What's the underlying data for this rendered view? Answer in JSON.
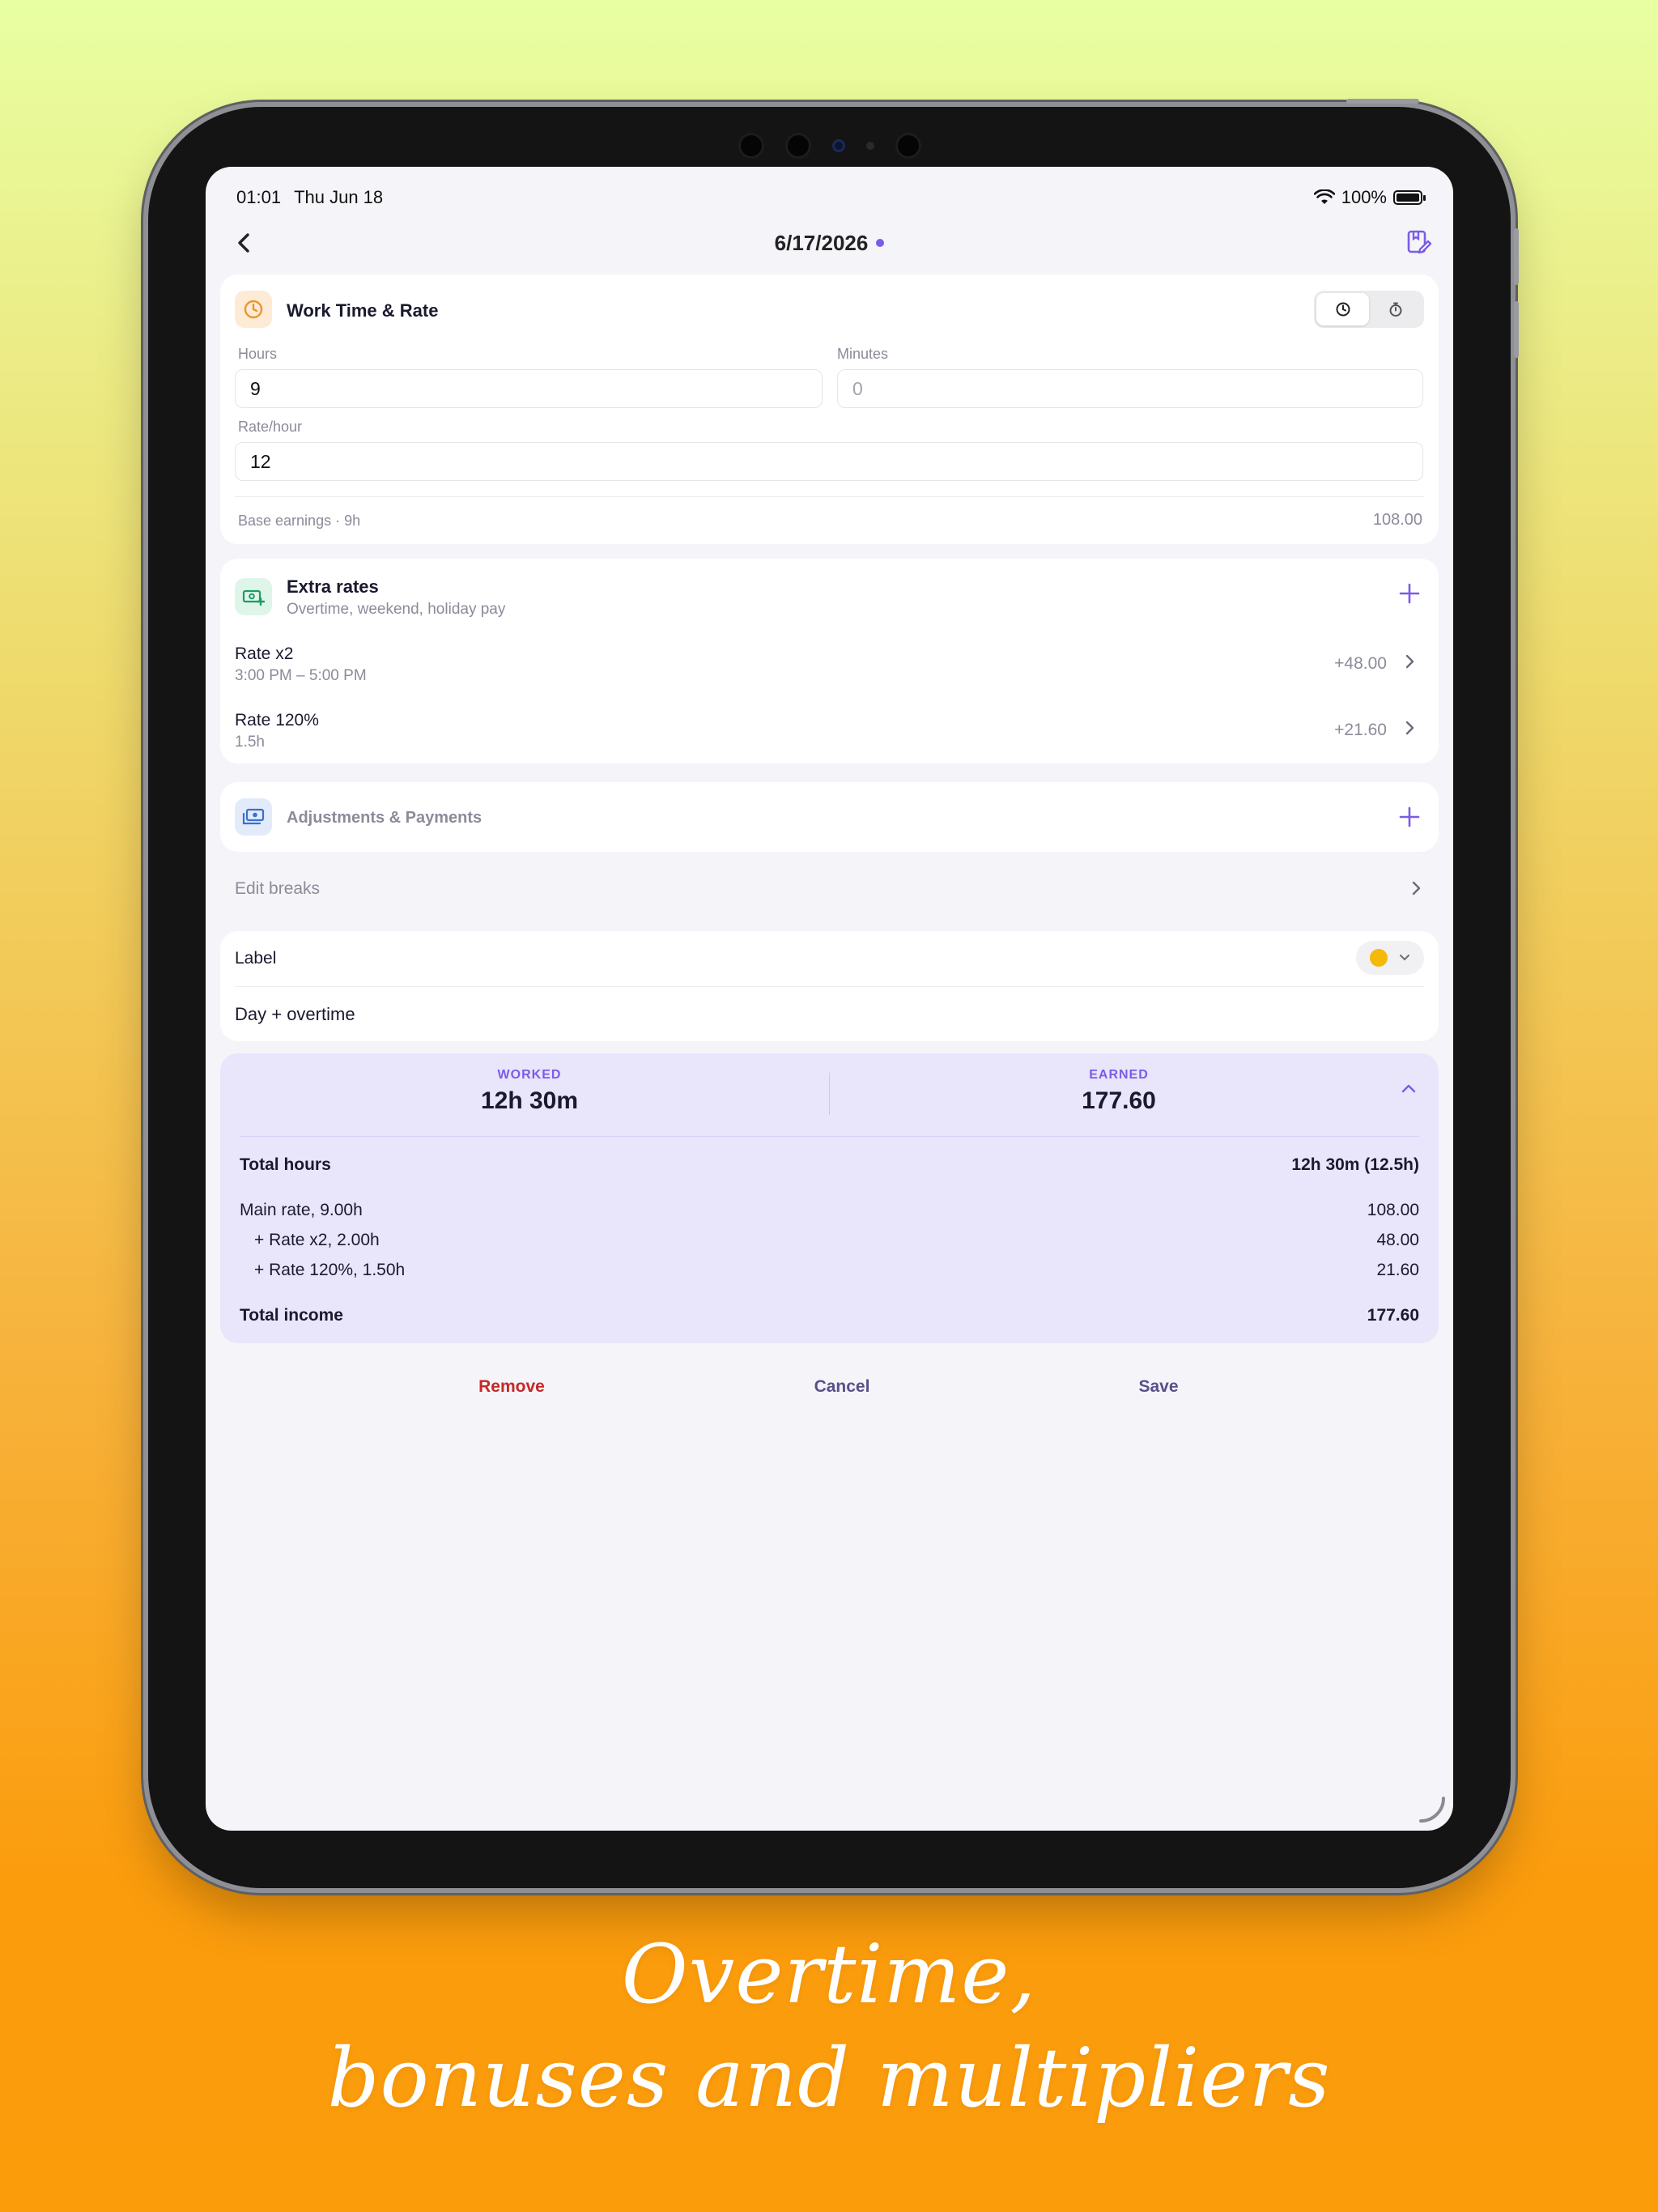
{
  "status": {
    "time": "01:01",
    "date": "Thu Jun 18",
    "battery": "100%"
  },
  "nav": {
    "title": "6/17/2026"
  },
  "work": {
    "title": "Work Time & Rate",
    "hours_label": "Hours",
    "hours_value": "9",
    "minutes_label": "Minutes",
    "minutes_placeholder": "0",
    "rate_label": "Rate/hour",
    "rate_value": "12",
    "base_label": "Base earnings · 9h",
    "base_value": "108.00"
  },
  "extra": {
    "title": "Extra rates",
    "subtitle": "Overtime, weekend, holiday pay",
    "items": [
      {
        "name": "Rate x2",
        "detail": "3:00 PM – 5:00 PM",
        "amount": "+48.00"
      },
      {
        "name": "Rate 120%",
        "detail": "1.5h",
        "amount": "+21.60"
      }
    ]
  },
  "adjustments": {
    "title": "Adjustments & Payments"
  },
  "breaks": {
    "label": "Edit breaks"
  },
  "label_section": {
    "title": "Label",
    "value": "Day + overtime",
    "color": "#f5b90a"
  },
  "summary": {
    "worked_label": "WORKED",
    "worked_value": "12h 30m",
    "earned_label": "EARNED",
    "earned_value": "177.60",
    "total_hours_label": "Total hours",
    "total_hours_value": "12h 30m (12.5h)",
    "lines": [
      {
        "label": "Main rate, 9.00h",
        "value": "108.00"
      },
      {
        "label": "+ Rate x2, 2.00h",
        "value": "48.00"
      },
      {
        "label": "+ Rate 120%, 1.50h",
        "value": "21.60"
      }
    ],
    "total_income_label": "Total income",
    "total_income_value": "177.60"
  },
  "actions": {
    "remove": "Remove",
    "cancel": "Cancel",
    "save": "Save"
  },
  "caption": {
    "line1": "Overtime,",
    "line2": "bonuses and multipliers"
  },
  "colors": {
    "accent": "#7b5ce6",
    "danger": "#c62828",
    "neutral_action": "#5b4f8a"
  }
}
